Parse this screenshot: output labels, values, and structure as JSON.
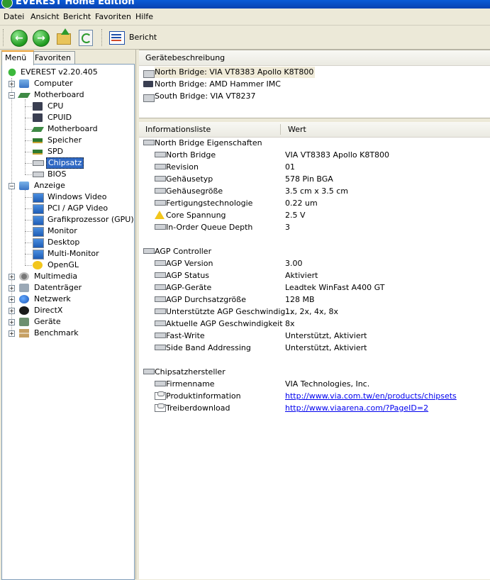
{
  "window": {
    "title": "EVEREST Home Edition"
  },
  "menubar": [
    "Datei",
    "Ansicht",
    "Bericht",
    "Favoriten",
    "Hilfe"
  ],
  "toolbar": {
    "buttons": [
      {
        "name": "back",
        "icon": "arrow-left-icon"
      },
      {
        "name": "forward",
        "icon": "arrow-right-icon"
      },
      {
        "name": "up",
        "icon": "folder-up-icon"
      },
      {
        "name": "refresh",
        "icon": "refresh-icon"
      }
    ],
    "report_label": "Bericht"
  },
  "left_panel": {
    "tabs": [
      "Menü",
      "Favoriten"
    ],
    "active_tab": "Menü",
    "tree": [
      {
        "label": "EVEREST v2.20.405",
        "level": 0,
        "icon": "everest-icon"
      },
      {
        "label": "Computer",
        "level": 1,
        "icon": "computer-icon",
        "toggle": "+"
      },
      {
        "label": "Motherboard",
        "level": 1,
        "icon": "motherboard-icon",
        "toggle": "-"
      },
      {
        "label": "CPU",
        "level": 2,
        "icon": "cpu-chip-icon"
      },
      {
        "label": "CPUID",
        "level": 2,
        "icon": "cpu-chip-icon"
      },
      {
        "label": "Motherboard",
        "level": 2,
        "icon": "motherboard-icon"
      },
      {
        "label": "Speicher",
        "level": 2,
        "icon": "memory-icon"
      },
      {
        "label": "SPD",
        "level": 2,
        "icon": "memory-icon"
      },
      {
        "label": "Chipsatz",
        "level": 2,
        "icon": "chipset-icon",
        "selected": true
      },
      {
        "label": "BIOS",
        "level": 2,
        "icon": "chipset-icon"
      },
      {
        "label": "Anzeige",
        "level": 1,
        "icon": "display-icon",
        "toggle": "-"
      },
      {
        "label": "Windows Video",
        "level": 2,
        "icon": "monitor-icon"
      },
      {
        "label": "PCI / AGP Video",
        "level": 2,
        "icon": "monitor-icon"
      },
      {
        "label": "Grafikprozessor (GPU)",
        "level": 2,
        "icon": "monitor-icon"
      },
      {
        "label": "Monitor",
        "level": 2,
        "icon": "monitor-icon"
      },
      {
        "label": "Desktop",
        "level": 2,
        "icon": "desktop-icon"
      },
      {
        "label": "Multi-Monitor",
        "level": 2,
        "icon": "monitor-icon"
      },
      {
        "label": "OpenGL",
        "level": 2,
        "icon": "opengl-icon"
      },
      {
        "label": "Multimedia",
        "level": 1,
        "icon": "multimedia-icon",
        "toggle": "+"
      },
      {
        "label": "Datenträger",
        "level": 1,
        "icon": "disk-icon",
        "toggle": "+"
      },
      {
        "label": "Netzwerk",
        "level": 1,
        "icon": "network-icon",
        "toggle": "+"
      },
      {
        "label": "DirectX",
        "level": 1,
        "icon": "directx-icon",
        "toggle": "+"
      },
      {
        "label": "Geräte",
        "level": 1,
        "icon": "devices-icon",
        "toggle": "+"
      },
      {
        "label": "Benchmark",
        "level": 1,
        "icon": "benchmark-icon",
        "toggle": "+"
      }
    ]
  },
  "device_pane": {
    "header": "Gerätebeschreibung",
    "items": [
      {
        "label": "North Bridge: VIA VT8383 Apollo K8T800",
        "icon": "chipset-icon",
        "highlighted": true
      },
      {
        "label": "North Bridge: AMD Hammer IMC",
        "icon": "cpu-chip-icon"
      },
      {
        "label": "South Bridge: VIA VT8237",
        "icon": "chipset-icon"
      }
    ]
  },
  "info_pane": {
    "columns": [
      "Informationsliste",
      "Wert"
    ],
    "rows": [
      {
        "type": "group",
        "field": "North Bridge Eigenschaften"
      },
      {
        "type": "item",
        "field": "North Bridge",
        "value": "VIA VT8383 Apollo K8T800"
      },
      {
        "type": "item",
        "field": "Revision",
        "value": "01"
      },
      {
        "type": "item",
        "field": "Gehäusetyp",
        "value": "578 Pin BGA"
      },
      {
        "type": "item",
        "field": "Gehäusegröße",
        "value": "3.5 cm x 3.5 cm"
      },
      {
        "type": "item",
        "field": "Fertigungstechnologie",
        "value": "0.22 um"
      },
      {
        "type": "item",
        "field": "Core Spannung",
        "value": "2.5 V",
        "icon": "warning-icon"
      },
      {
        "type": "item",
        "field": "In-Order Queue Depth",
        "value": "3"
      },
      {
        "type": "spacer"
      },
      {
        "type": "group",
        "field": "AGP Controller"
      },
      {
        "type": "item",
        "field": "AGP Version",
        "value": "3.00"
      },
      {
        "type": "item",
        "field": "AGP Status",
        "value": "Aktiviert"
      },
      {
        "type": "item",
        "field": "AGP-Geräte",
        "value": "Leadtek WinFast A400 GT"
      },
      {
        "type": "item",
        "field": "AGP Durchsatzgröße",
        "value": "128 MB"
      },
      {
        "type": "item",
        "field": "Unterstützte AGP Geschwindig...",
        "value": "1x, 2x, 4x, 8x"
      },
      {
        "type": "item",
        "field": "Aktuelle AGP Geschwindigkeit",
        "value": "8x"
      },
      {
        "type": "item",
        "field": "Fast-Write",
        "value": "Unterstützt, Aktiviert"
      },
      {
        "type": "item",
        "field": "Side Band Addressing",
        "value": "Unterstützt, Aktiviert"
      },
      {
        "type": "spacer"
      },
      {
        "type": "group",
        "field": "Chipsatzhersteller"
      },
      {
        "type": "item",
        "field": "Firmenname",
        "value": "VIA Technologies, Inc."
      },
      {
        "type": "item",
        "field": "Produktinformation",
        "value": "http://www.via.com.tw/en/products/chipsets",
        "link": true,
        "icon": "link-icon"
      },
      {
        "type": "item",
        "field": "Treiberdownload",
        "value": "http://www.viaarena.com/?PageID=2",
        "link": true,
        "icon": "link-icon"
      }
    ]
  }
}
